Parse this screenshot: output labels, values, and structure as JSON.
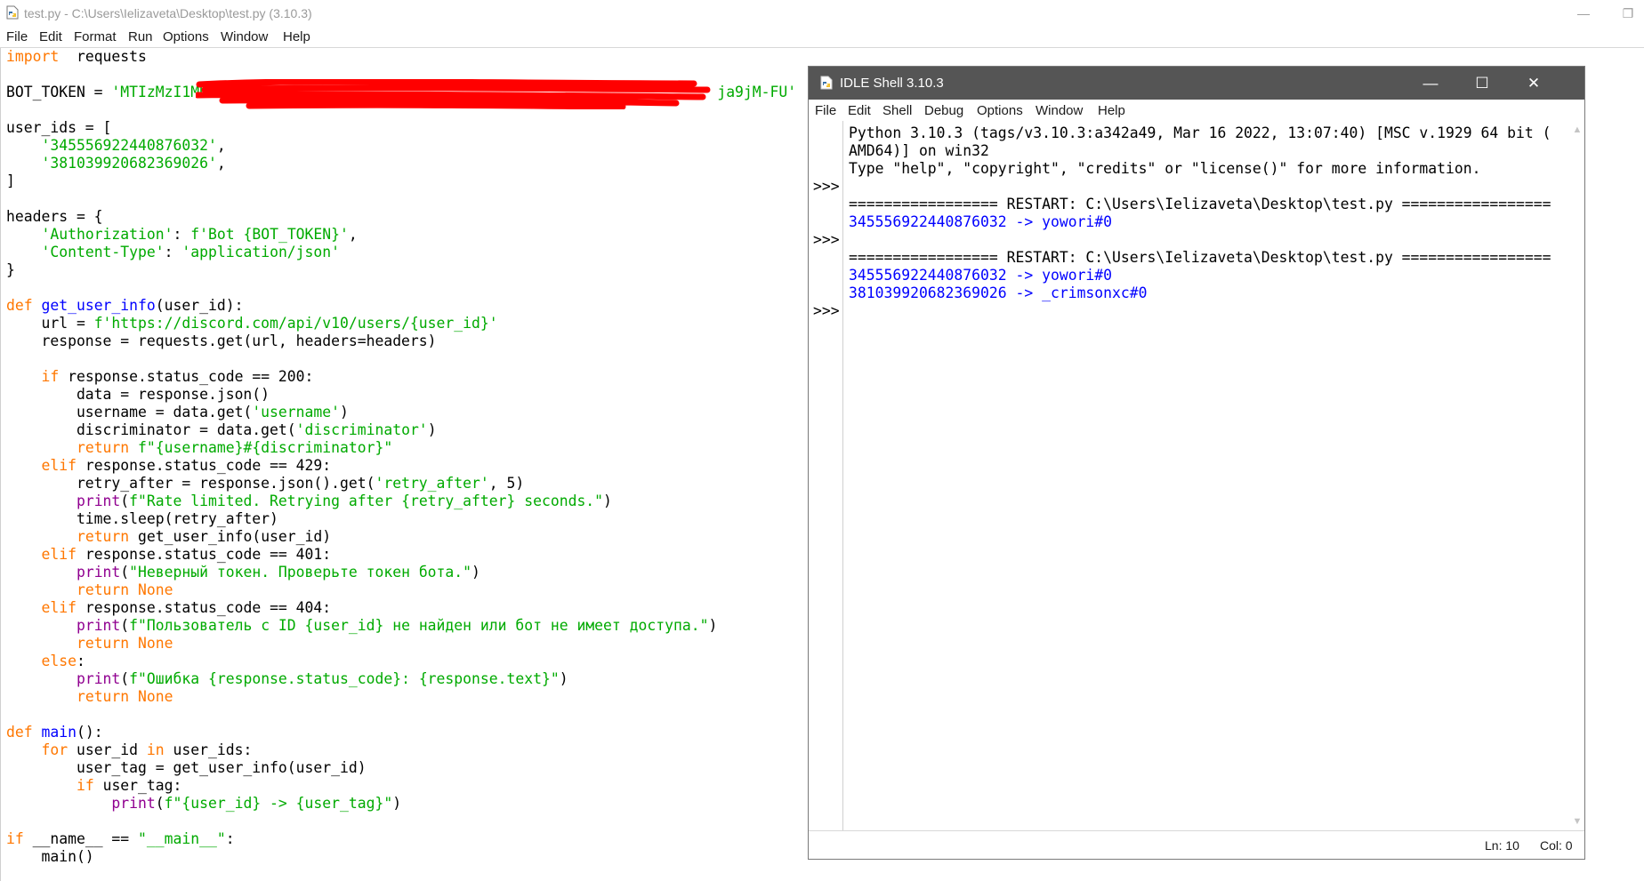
{
  "editor": {
    "title": "test.py - C:\\Users\\Ielizaveta\\Desktop\\test.py (3.10.3)",
    "menu": [
      "File",
      "Edit",
      "Format",
      "Run",
      "Options",
      "Window",
      "Help"
    ],
    "window_buttons": {
      "minimize": "—",
      "restore": "❐"
    },
    "code_lines": [
      [
        [
          "kw",
          "import"
        ],
        [
          "",
          "  requests"
        ]
      ],
      [],
      [
        [
          "",
          "BOT_TOKEN = "
        ],
        [
          "st",
          "'MTIzMzI1MDE"
        ],
        [
          "st",
          "                                                         ja9jM-FU'"
        ]
      ],
      [],
      [
        [
          "",
          "user_ids = ["
        ]
      ],
      [
        [
          "",
          "    "
        ],
        [
          "st",
          "'345556922440876032'"
        ],
        [
          "",
          ","
        ]
      ],
      [
        [
          "",
          "    "
        ],
        [
          "st",
          "'381039920682369026'"
        ],
        [
          "",
          ","
        ]
      ],
      [
        [
          "",
          "]"
        ]
      ],
      [],
      [
        [
          "",
          "headers = {"
        ]
      ],
      [
        [
          "",
          "    "
        ],
        [
          "st",
          "'Authorization'"
        ],
        [
          "",
          ": "
        ],
        [
          "st",
          "f'Bot {BOT_TOKEN}'"
        ],
        [
          "",
          ","
        ]
      ],
      [
        [
          "",
          "    "
        ],
        [
          "st",
          "'Content-Type'"
        ],
        [
          "",
          ": "
        ],
        [
          "st",
          "'application/json'"
        ]
      ],
      [
        [
          "",
          "}"
        ]
      ],
      [],
      [
        [
          "kw",
          "def"
        ],
        [
          "",
          " "
        ],
        [
          "df",
          "get_user_info"
        ],
        [
          "",
          "(user_id):"
        ]
      ],
      [
        [
          "",
          "    url = "
        ],
        [
          "st",
          "f'https://discord.com/api/v10/users/{user_id}'"
        ]
      ],
      [
        [
          "",
          "    response = requests.get(url, headers=headers)"
        ]
      ],
      [],
      [
        [
          "",
          "    "
        ],
        [
          "kw",
          "if"
        ],
        [
          "",
          " response.status_code == 200:"
        ]
      ],
      [
        [
          "",
          "        data = response.json()"
        ]
      ],
      [
        [
          "",
          "        username = data.get("
        ],
        [
          "st",
          "'username'"
        ],
        [
          "",
          ")"
        ]
      ],
      [
        [
          "",
          "        discriminator = data.get("
        ],
        [
          "st",
          "'discriminator'"
        ],
        [
          "",
          ")"
        ]
      ],
      [
        [
          "",
          "        "
        ],
        [
          "kw",
          "return"
        ],
        [
          "",
          " "
        ],
        [
          "st",
          "f\"{username}#{discriminator}\""
        ]
      ],
      [
        [
          "",
          "    "
        ],
        [
          "kw",
          "elif"
        ],
        [
          "",
          " response.status_code == 429:"
        ]
      ],
      [
        [
          "",
          "        retry_after = response.json().get("
        ],
        [
          "st",
          "'retry_after'"
        ],
        [
          "",
          ", 5)"
        ]
      ],
      [
        [
          "",
          "        "
        ],
        [
          "bi",
          "print"
        ],
        [
          "",
          "("
        ],
        [
          "st",
          "f\"Rate limited. Retrying after {retry_after} seconds.\""
        ],
        [
          "",
          ")"
        ]
      ],
      [
        [
          "",
          "        time.sleep(retry_after)"
        ]
      ],
      [
        [
          "",
          "        "
        ],
        [
          "kw",
          "return"
        ],
        [
          "",
          " get_user_info(user_id)"
        ]
      ],
      [
        [
          "",
          "    "
        ],
        [
          "kw",
          "elif"
        ],
        [
          "",
          " response.status_code == 401:"
        ]
      ],
      [
        [
          "",
          "        "
        ],
        [
          "bi",
          "print"
        ],
        [
          "",
          "("
        ],
        [
          "st",
          "\"Неверный токен. Проверьте токен бота.\""
        ],
        [
          "",
          ")"
        ]
      ],
      [
        [
          "",
          "        "
        ],
        [
          "kw",
          "return"
        ],
        [
          "",
          " "
        ],
        [
          "kw",
          "None"
        ]
      ],
      [
        [
          "",
          "    "
        ],
        [
          "kw",
          "elif"
        ],
        [
          "",
          " response.status_code == 404:"
        ]
      ],
      [
        [
          "",
          "        "
        ],
        [
          "bi",
          "print"
        ],
        [
          "",
          "("
        ],
        [
          "st",
          "f\"Пользователь с ID {user_id} не найден или бот не имеет доступа.\""
        ],
        [
          "",
          ")"
        ]
      ],
      [
        [
          "",
          "        "
        ],
        [
          "kw",
          "return"
        ],
        [
          "",
          " "
        ],
        [
          "kw",
          "None"
        ]
      ],
      [
        [
          "",
          "    "
        ],
        [
          "kw",
          "else"
        ],
        [
          "",
          ":"
        ]
      ],
      [
        [
          "",
          "        "
        ],
        [
          "bi",
          "print"
        ],
        [
          "",
          "("
        ],
        [
          "st",
          "f\"Ошибка {response.status_code}: {response.text}\""
        ],
        [
          "",
          ")"
        ]
      ],
      [
        [
          "",
          "        "
        ],
        [
          "kw",
          "return"
        ],
        [
          "",
          " "
        ],
        [
          "kw",
          "None"
        ]
      ],
      [],
      [
        [
          "kw",
          "def"
        ],
        [
          "",
          " "
        ],
        [
          "df",
          "main"
        ],
        [
          "",
          "():"
        ]
      ],
      [
        [
          "",
          "    "
        ],
        [
          "kw",
          "for"
        ],
        [
          "",
          " user_id "
        ],
        [
          "kw",
          "in"
        ],
        [
          "",
          " user_ids:"
        ]
      ],
      [
        [
          "",
          "        user_tag = get_user_info(user_id)"
        ]
      ],
      [
        [
          "",
          "        "
        ],
        [
          "kw",
          "if"
        ],
        [
          "",
          " user_tag:"
        ]
      ],
      [
        [
          "",
          "            "
        ],
        [
          "bi",
          "print"
        ],
        [
          "",
          "("
        ],
        [
          "st",
          "f\"{user_id} -> {user_tag}\""
        ],
        [
          "",
          ")"
        ]
      ],
      [],
      [
        [
          "kw",
          "if"
        ],
        [
          "",
          " __name__ == "
        ],
        [
          "st",
          "\"__main__\""
        ],
        [
          "",
          ":"
        ]
      ],
      [
        [
          "",
          "    main()"
        ]
      ]
    ]
  },
  "shell": {
    "title": "IDLE Shell 3.10.3",
    "menu": [
      "File",
      "Edit",
      "Shell",
      "Debug",
      "Options",
      "Window",
      "Help"
    ],
    "window_buttons": {
      "minimize": "—",
      "maximize": "☐",
      "close": "✕"
    },
    "prompt": ">>>",
    "lines": [
      {
        "row": 0,
        "kind": "text",
        "text": "Python 3.10.3 (tags/v3.10.3:a342a49, Mar 16 2022, 13:07:40) [MSC v.1929 64 bit ("
      },
      {
        "row": 1,
        "kind": "text",
        "text": "AMD64)] on win32"
      },
      {
        "row": 2,
        "kind": "text",
        "text": "Type \"help\", \"copyright\", \"credits\" or \"license()\" for more information."
      },
      {
        "row": 4,
        "kind": "text",
        "text": "================= RESTART: C:\\Users\\Ielizaveta\\Desktop\\test.py ================="
      },
      {
        "row": 5,
        "kind": "out",
        "text": "345556922440876032 -> yowori#0"
      },
      {
        "row": 7,
        "kind": "text",
        "text": "================= RESTART: C:\\Users\\Ielizaveta\\Desktop\\test.py ================="
      },
      {
        "row": 8,
        "kind": "out",
        "text": "345556922440876032 -> yowori#0"
      },
      {
        "row": 9,
        "kind": "out",
        "text": "381039920682369026 -> _crimsonxc#0"
      }
    ],
    "prompt_rows": [
      3,
      6,
      10
    ],
    "status": {
      "line": "Ln: 10",
      "col": "Col: 0"
    }
  },
  "colors": {
    "keyword": "#ff7700",
    "builtin": "#900090",
    "string": "#00aa00",
    "definition": "#0000ff",
    "shell_output": "#0000ff",
    "shell_titlebar": "#555555",
    "redaction": "#ff0000"
  },
  "icons": {
    "editor_app": "python-file-icon",
    "shell_app": "python-idle-icon"
  }
}
